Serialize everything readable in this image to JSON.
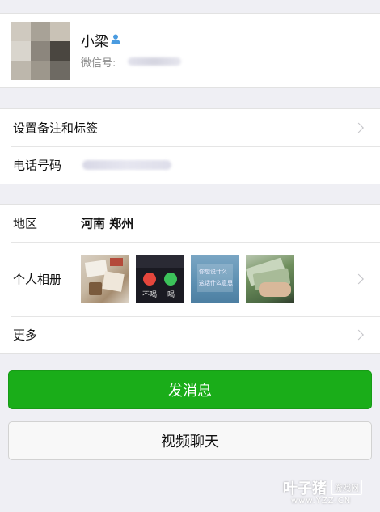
{
  "profile": {
    "name": "小梁",
    "wechat_id_label": "微信号:",
    "contact_icon": "person-icon"
  },
  "rows": {
    "remark_label": "设置备注和标签",
    "phone_label": "电话号码",
    "region_label": "地区",
    "region_value": "河南 郑州",
    "album_label": "个人相册",
    "more_label": "更多"
  },
  "album": {
    "photo2_left_text": "不喝",
    "photo2_right_text": "喝",
    "photo3_line1": "你想说什么",
    "photo3_line2": "这话什么意思"
  },
  "actions": {
    "send_message": "发消息",
    "video_chat": "视频聊天"
  },
  "watermark": {
    "brand": "叶子猪",
    "tag": "游戏网",
    "url": "www.YZZ.CN"
  },
  "colors": {
    "primary_green": "#1aad19",
    "background": "#efeff4",
    "chevron": "#c4c4c8"
  }
}
